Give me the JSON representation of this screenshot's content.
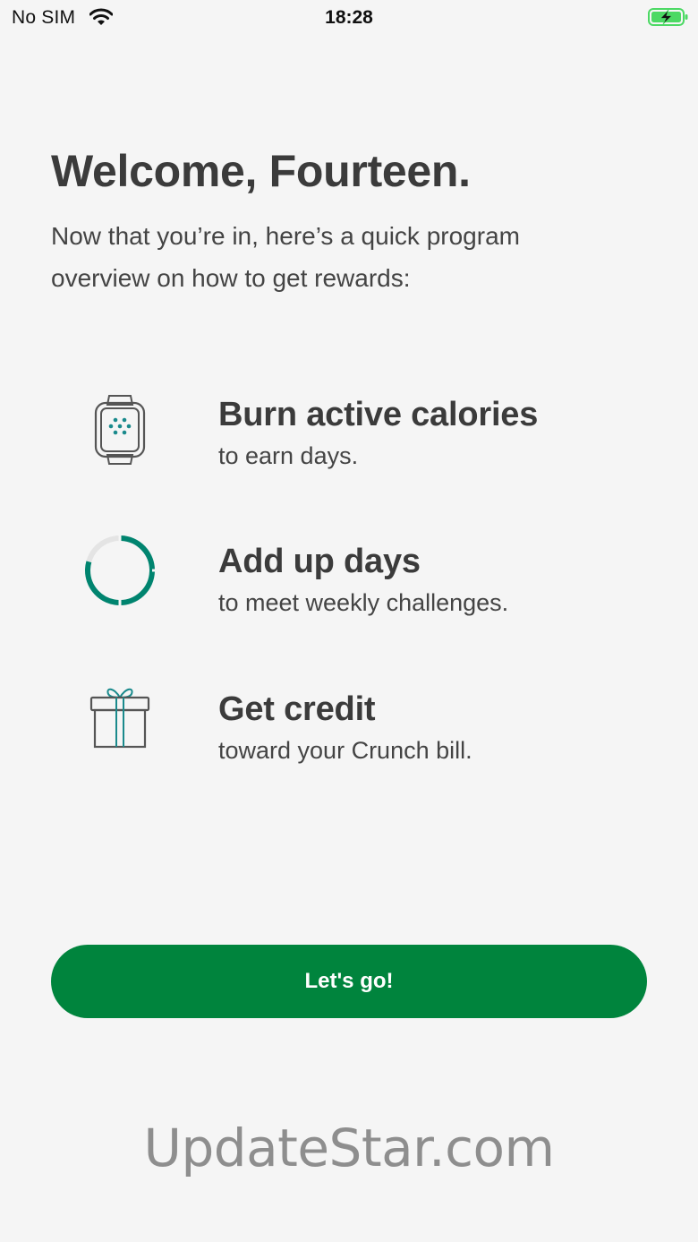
{
  "status_bar": {
    "carrier": "No SIM",
    "time": "18:28",
    "wifi_icon": "wifi-icon",
    "battery_icon": "battery-charging-icon",
    "battery_color": "#4cd964"
  },
  "welcome": {
    "title": "Welcome, Fourteen.",
    "subtitle": "Now that you’re in, here’s a quick program overview on how to get rewards:"
  },
  "features": [
    {
      "icon": "smartwatch-icon",
      "title": "Burn active calories",
      "description": "to earn days."
    },
    {
      "icon": "progress-ring-icon",
      "title": "Add up days",
      "description": "to meet weekly challenges."
    },
    {
      "icon": "gift-icon",
      "title": "Get credit",
      "description": "toward your Crunch bill."
    }
  ],
  "cta": {
    "label": "Let's go!",
    "color": "#00843d"
  },
  "watermark": "UpdateStar.com",
  "colors": {
    "accent_teal": "#1a8a8c",
    "text_dark": "#3b3b3b",
    "background": "#f5f5f5"
  }
}
